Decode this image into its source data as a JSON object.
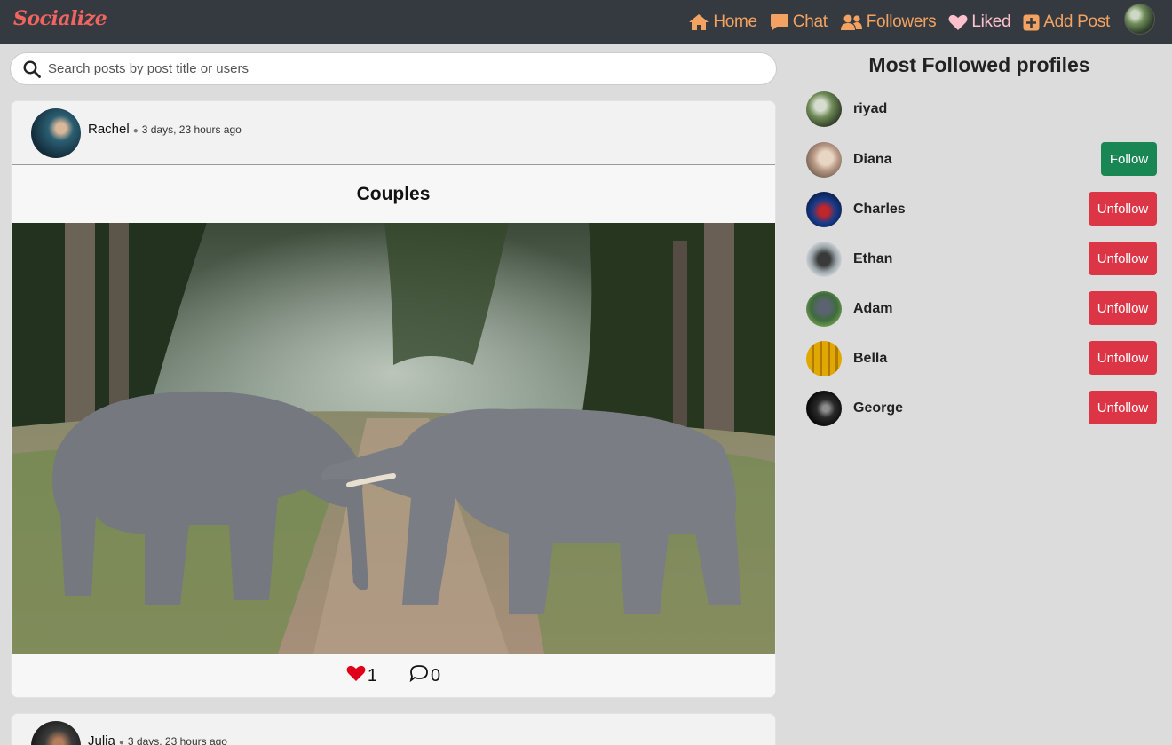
{
  "navbar": {
    "brand": "Socialize",
    "links": [
      {
        "label": "Home",
        "icon": "home-icon"
      },
      {
        "label": "Chat",
        "icon": "chat-icon"
      },
      {
        "label": "Followers",
        "icon": "users-icon"
      },
      {
        "label": "Liked",
        "icon": "heart-icon"
      },
      {
        "label": "Add Post",
        "icon": "plus-square-icon"
      }
    ],
    "accent": "#f4a261",
    "brand_color": "#f2645f"
  },
  "search": {
    "placeholder": "Search posts by post title or users"
  },
  "feed": {
    "posts": [
      {
        "user": "Rachel",
        "time": "3 days, 23 hours ago",
        "title": "Couples",
        "likes": "1",
        "comments": "0"
      },
      {
        "user": "Julia",
        "time": "3 days, 23 hours ago"
      }
    ]
  },
  "sidebar": {
    "title": "Most Followed profiles",
    "profiles": [
      {
        "name": "riyad",
        "action": ""
      },
      {
        "name": "Diana",
        "action": "Follow"
      },
      {
        "name": "Charles",
        "action": "Unfollow"
      },
      {
        "name": "Ethan",
        "action": "Unfollow"
      },
      {
        "name": "Adam",
        "action": "Unfollow"
      },
      {
        "name": "Bella",
        "action": "Unfollow"
      },
      {
        "name": "George",
        "action": "Unfollow"
      }
    ]
  },
  "colors": {
    "follow": "#198754",
    "unfollow": "#dc3545",
    "like": "#e0001a"
  }
}
